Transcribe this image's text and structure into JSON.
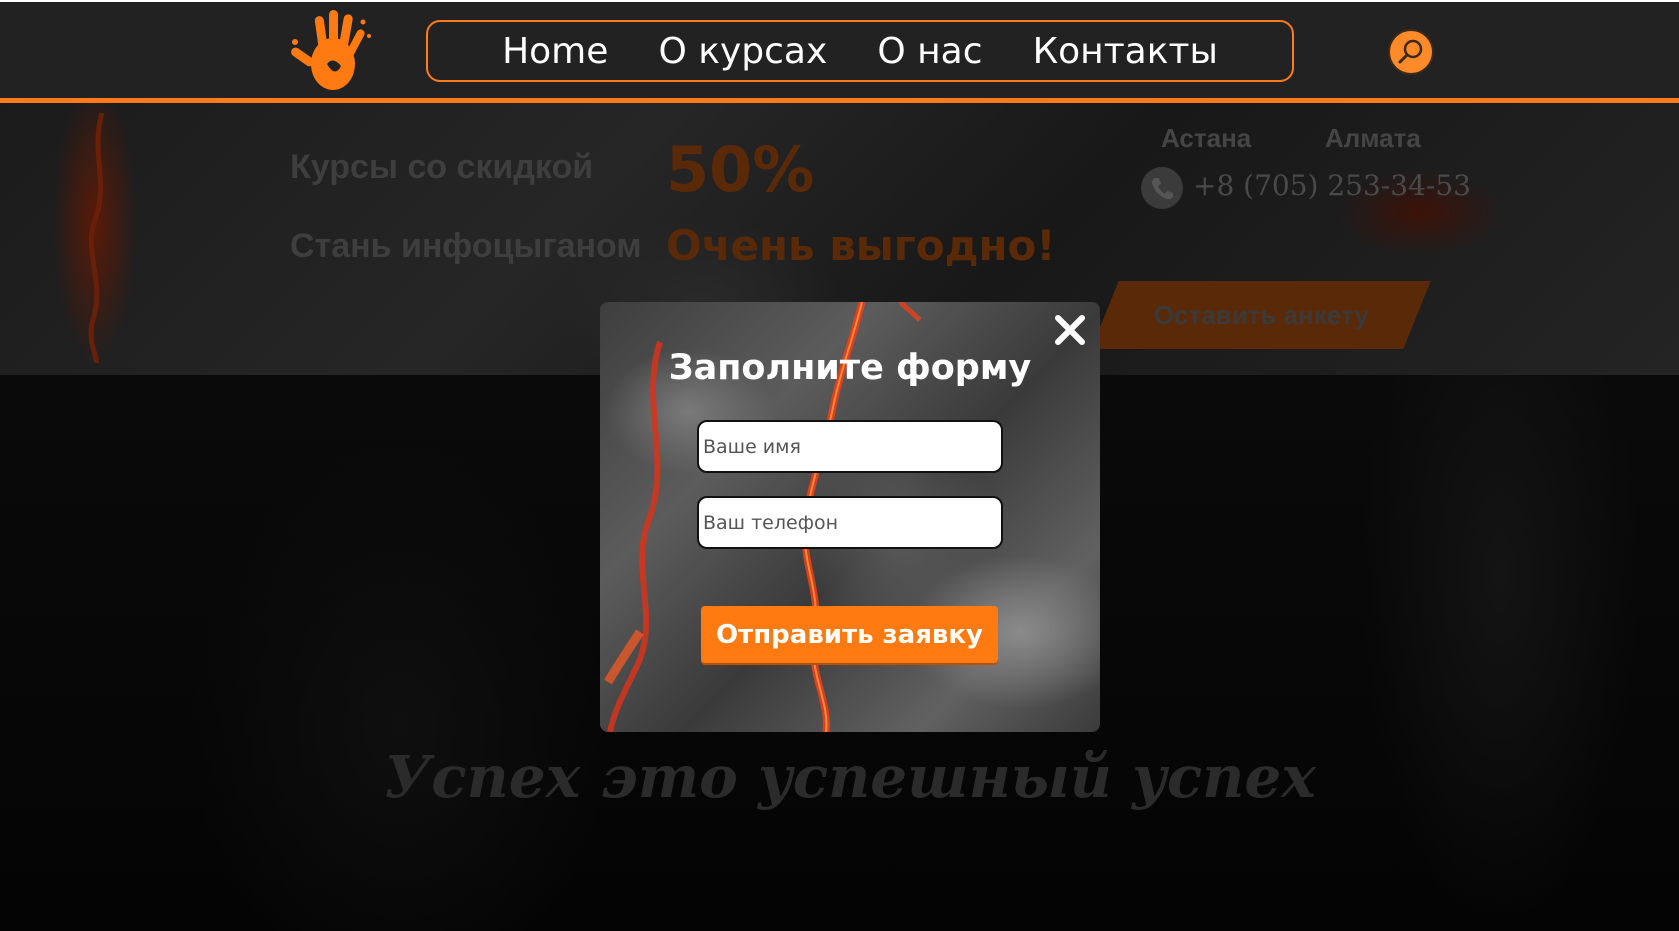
{
  "header": {
    "logo_icon": "orange-hand-icon",
    "nav": [
      {
        "label": "Home"
      },
      {
        "label": "О курсах"
      },
      {
        "label": "О нас"
      },
      {
        "label": "Контакты"
      }
    ],
    "search_icon": "search-icon"
  },
  "hero": {
    "line1_label": "Курсы со скидкой",
    "line1_value": "50%",
    "line2_label": "Стань инфоцыганом",
    "line2_value": "Очень выгодно!",
    "cities": [
      "Астана",
      "Алмата"
    ],
    "phone": "+8 (705) 253-34-53",
    "cta_label": "Оставить анкету"
  },
  "slogan": "Успех это успешный успех",
  "modal": {
    "title": "Заполните форму",
    "name_placeholder": "Ваше имя",
    "phone_placeholder": "Ваш телефон",
    "submit_label": "Отправить заявку",
    "close_icon": "close-icon"
  },
  "colors": {
    "accent": "#ff7a1a",
    "header_bg": "#232223",
    "button": "#ff7a10"
  }
}
